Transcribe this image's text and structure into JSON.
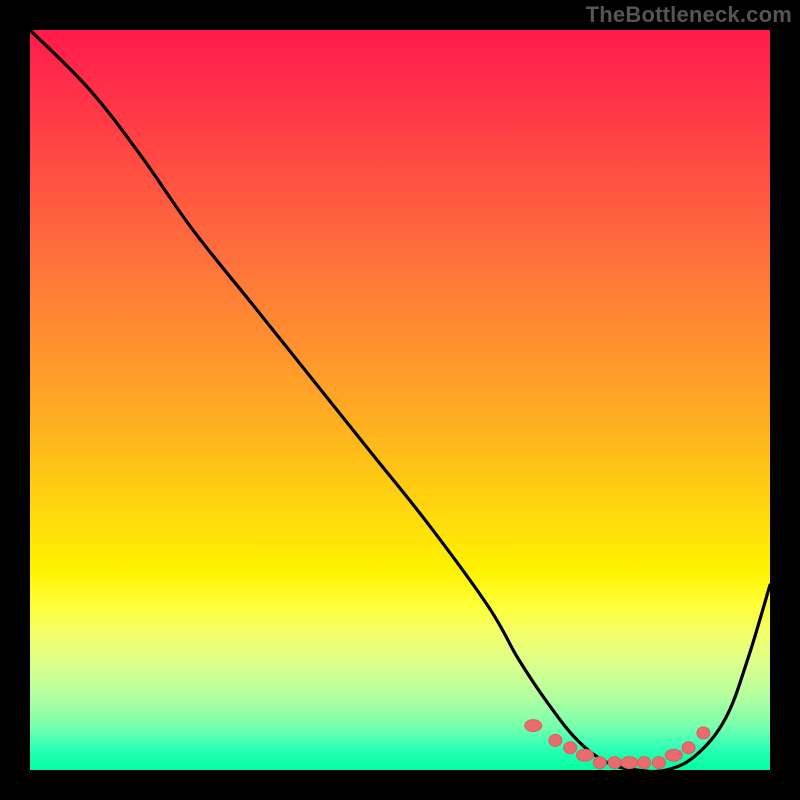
{
  "watermark": "TheBottleneck.com",
  "colors": {
    "background": "#000000",
    "curve": "#000000",
    "marker_fill": "#e96b6e",
    "marker_stroke": "#d95f63",
    "gradient_top": "#ff1a4a",
    "gradient_bottom": "#00ff9f"
  },
  "chart_data": {
    "type": "line",
    "title": "",
    "xlabel": "",
    "ylabel": "",
    "xlim": [
      0,
      100
    ],
    "ylim": [
      0,
      100
    ],
    "grid": false,
    "legend": false,
    "series": [
      {
        "name": "bottleneck-curve",
        "x": [
          0,
          8,
          15,
          22,
          30,
          38,
          46,
          54,
          62,
          66,
          70,
          74,
          78,
          82,
          86,
          90,
          94,
          97,
          100
        ],
        "y": [
          100,
          92,
          83,
          73,
          63,
          53,
          43,
          33,
          22,
          15,
          9,
          4,
          1,
          0,
          0,
          2,
          7,
          15,
          25
        ]
      }
    ],
    "markers": {
      "name": "optimal-region-dots",
      "x": [
        68,
        71,
        73,
        75,
        77,
        79,
        81,
        83,
        85,
        87,
        89,
        91
      ],
      "y": [
        6,
        4,
        3,
        2,
        1,
        1,
        1,
        1,
        1,
        2,
        3,
        5
      ]
    }
  }
}
